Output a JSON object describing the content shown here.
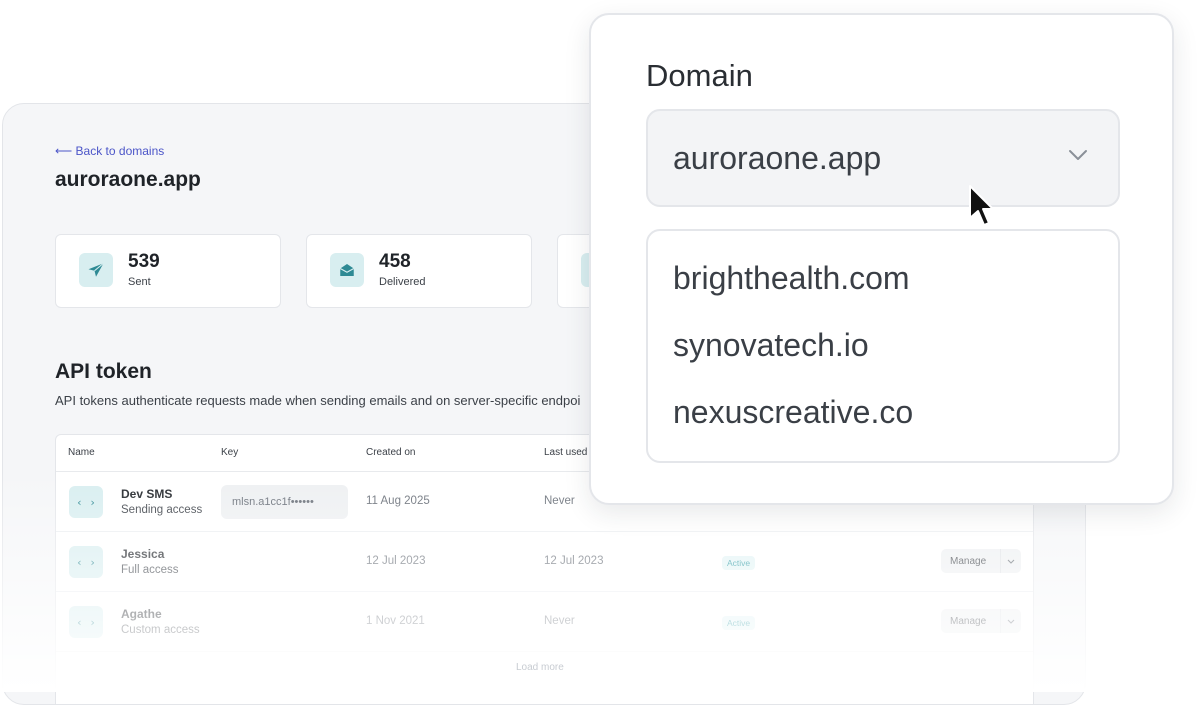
{
  "app": {
    "back_link": "⟵ Back to domains",
    "title": "auroraone.app",
    "stats": [
      {
        "value": "539",
        "label": "Sent",
        "icon": "paper-plane-icon"
      },
      {
        "value": "458",
        "label": "Delivered",
        "icon": "envelope-open-icon"
      }
    ],
    "api_section": {
      "title": "API token",
      "description": "API tokens authenticate requests made when sending emails and on server-specific endpoi"
    },
    "table": {
      "headers": [
        "Name",
        "Key",
        "Created on",
        "Last used"
      ],
      "rows": [
        {
          "icon": "‹ ›",
          "name": "Dev SMS",
          "access": "Sending access",
          "key": "mlsn.a1cc1f••••••",
          "created": "11 Aug 2025",
          "last_used": "Never",
          "status": "",
          "action": ""
        },
        {
          "icon": "‹ ›",
          "name": "Jessica",
          "access": "Full access",
          "key": "",
          "created": "12 Jul 2023",
          "last_used": "12 Jul 2023",
          "status": "Active",
          "action": "Manage"
        },
        {
          "icon": "‹ ›",
          "name": "Agathe",
          "access": "Custom access",
          "key": "",
          "created": "1 Nov 2021",
          "last_used": "Never",
          "status": "Active",
          "action": "Manage"
        }
      ],
      "load_more": "Load more"
    }
  },
  "domain_select": {
    "label": "Domain",
    "selected": "auroraone.app",
    "options": [
      "brighthealth.com",
      "synovatech.io",
      "nexuscreative.co"
    ]
  },
  "colors": {
    "accent_teal": "#2e8a94",
    "icon_bg": "#d8eef0",
    "link": "#4b55c8"
  }
}
